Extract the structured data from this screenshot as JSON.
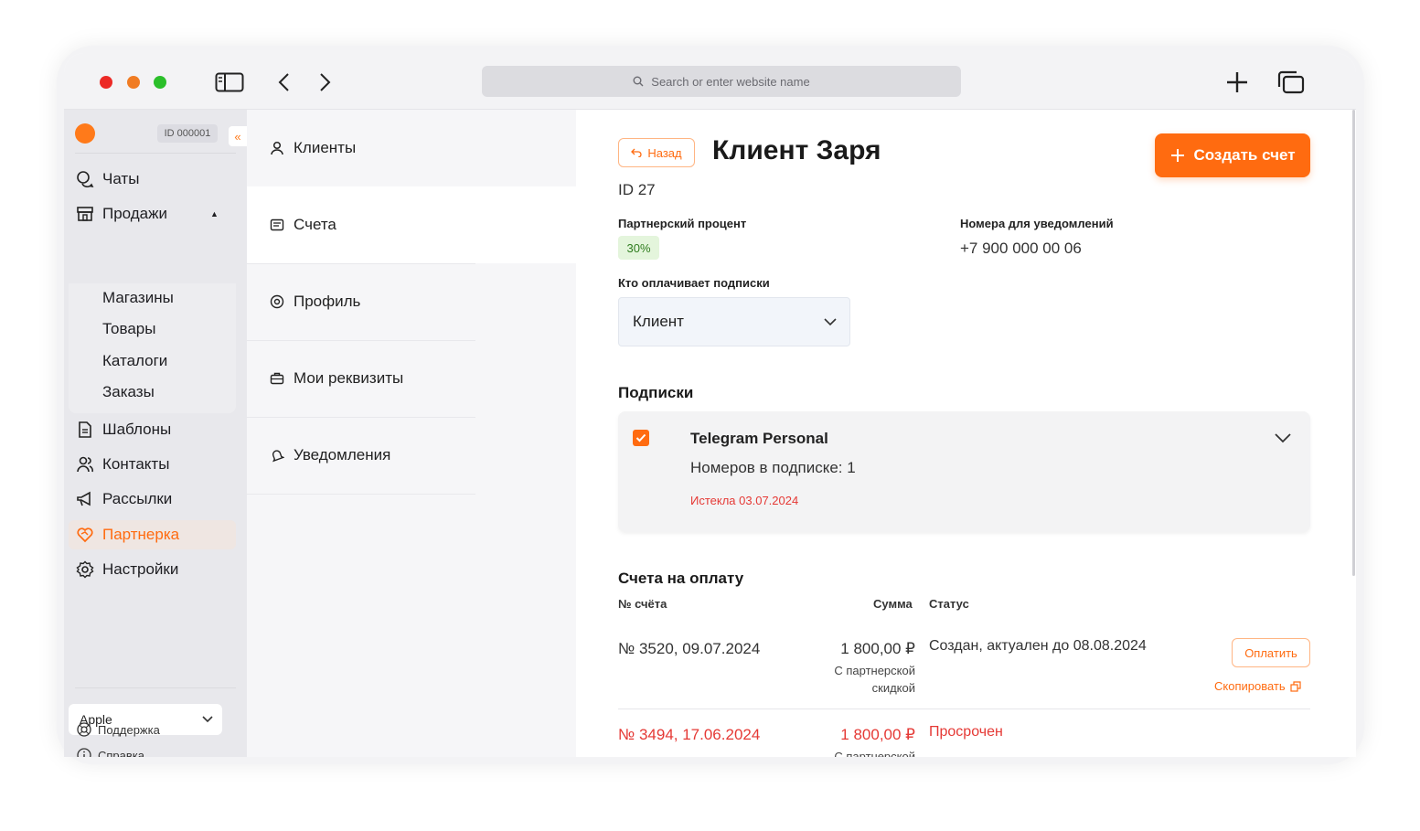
{
  "browser": {
    "url_placeholder": "Search or enter website name"
  },
  "sidebar": {
    "account_id": "ID 000001",
    "nav": [
      {
        "label": "Чаты",
        "icon": "chat-icon"
      },
      {
        "label": "Продажи",
        "icon": "store-icon"
      },
      {
        "label": "Шаблоны",
        "icon": "document-icon"
      },
      {
        "label": "Контакты",
        "icon": "contacts-icon"
      },
      {
        "label": "Рассылки",
        "icon": "megaphone-icon"
      },
      {
        "label": "Партнерка",
        "icon": "handshake-heart-icon"
      },
      {
        "label": "Настройки",
        "icon": "gear-icon"
      }
    ],
    "sales_sub": [
      "Магазины",
      "Товары",
      "Каталоги",
      "Заказы"
    ],
    "store_select": "Apple",
    "help": "Справка",
    "support": "Поддержка"
  },
  "section_nav": {
    "items": [
      {
        "label": "Клиенты",
        "icon": "user-icon"
      },
      {
        "label": "Счета",
        "icon": "invoice-icon"
      },
      {
        "label": "Профиль",
        "icon": "at-icon"
      },
      {
        "label": "Мои реквизиты",
        "icon": "briefcase-icon"
      },
      {
        "label": "Уведомления",
        "icon": "bell-icon"
      }
    ]
  },
  "client": {
    "back": "Назад",
    "title": "Клиент Заря",
    "create_invoice": "Создать счет",
    "id": "ID 27",
    "partner_percent_label": "Партнерский процент",
    "partner_percent": "30%",
    "notify_label": "Номера для уведомлений",
    "notify_phone": "+7 900 000 00 06",
    "payer_label": "Кто оплачивает подписки",
    "payer_value": "Клиент"
  },
  "subscriptions": {
    "title": "Подписки",
    "items": [
      {
        "name": "Telegram Personal",
        "count": "Номеров в подписке: 1",
        "status": "Истекла 03.07.2024"
      }
    ]
  },
  "invoices": {
    "title": "Счета на оплату",
    "headers": {
      "number": "№ счёта",
      "sum": "Сумма",
      "status": "Статус"
    },
    "rows": [
      {
        "number": "№ 3520, 09.07.2024",
        "sum": "1 800,00 ₽",
        "note1": "С партнерской",
        "note2": "скидкой",
        "status": "Создан, актуален до 08.08.2024",
        "pay": "Оплатить",
        "copy": "Скопировать"
      },
      {
        "number": "№ 3494, 17.06.2024",
        "sum": "1 800,00 ₽",
        "note1": "С партнерской",
        "status": "Просрочен"
      }
    ]
  },
  "colors": {
    "accent": "#ff6b10",
    "error": "#e53935",
    "success_bg": "#e4f5dc"
  }
}
